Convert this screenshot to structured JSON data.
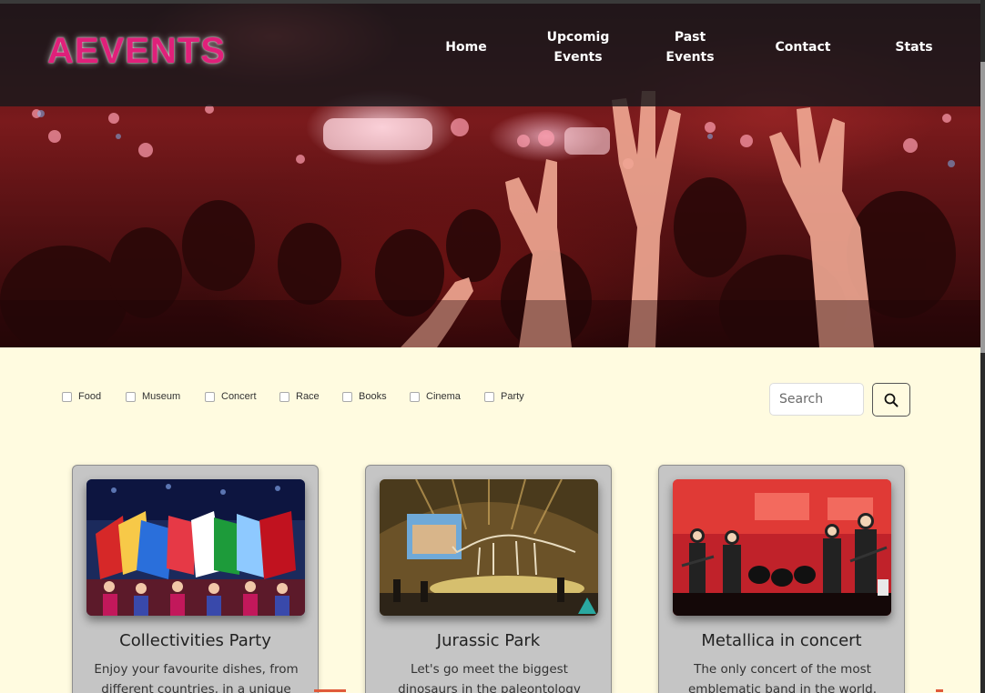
{
  "header": {
    "logo_text": "AEVENTS",
    "nav": [
      {
        "label": "Home"
      },
      {
        "label": "Upcomig Events"
      },
      {
        "label": "Past Events"
      },
      {
        "label": "Contact"
      },
      {
        "label": "Stats"
      }
    ]
  },
  "filters": [
    {
      "label": "Food",
      "checked": false
    },
    {
      "label": "Museum",
      "checked": false
    },
    {
      "label": "Concert",
      "checked": false
    },
    {
      "label": "Race",
      "checked": false
    },
    {
      "label": "Books",
      "checked": false
    },
    {
      "label": "Cinema",
      "checked": false
    },
    {
      "label": "Party",
      "checked": false
    }
  ],
  "search": {
    "placeholder": "Search",
    "value": "",
    "button_icon": "search-icon"
  },
  "cards": [
    {
      "title": "Collectivities Party",
      "description": "Enjoy your favourite dishes, from different countries, in a unique",
      "image": "flags-parade-photo"
    },
    {
      "title": "Jurassic Park",
      "description": "Let's go meet the biggest dinosaurs in the paleontology museum.",
      "image": "dinosaur-museum-photo"
    },
    {
      "title": "Metallica in concert",
      "description": "The only concert of the most emblematic band in the world.",
      "image": "rock-concert-photo"
    }
  ],
  "colors": {
    "brand": "#e0207a",
    "page_background": "#fffbe0",
    "card_background": "#c5c5c5",
    "navbar_background": "#19191c"
  }
}
